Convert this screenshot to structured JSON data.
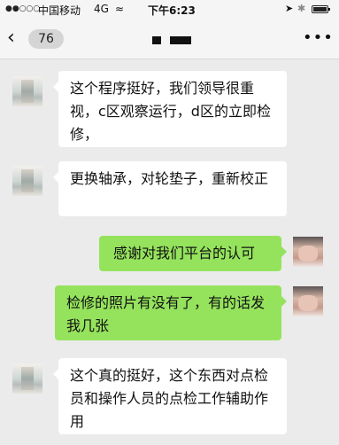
{
  "status_bar": {
    "signal": "●●○○○",
    "carrier": "中国移动",
    "network": "4G",
    "wifi": "≈",
    "time": "下午6:23",
    "location": "➤",
    "bluetooth": "✱"
  },
  "nav": {
    "back_glyph": "‹",
    "unread_count": "76",
    "more_glyph": "•••"
  },
  "messages": [
    {
      "side": "left",
      "text": "这个程序挺好，我们领导很重视，c区观察运行，d区的立即检修，"
    },
    {
      "side": "left",
      "text": "更换轴承，对轮垫子，重新校正"
    },
    {
      "side": "right",
      "text": "感谢对我们平台的认可"
    },
    {
      "side": "right",
      "text": "检修的照片有没有了，有的话发我几张"
    },
    {
      "side": "left",
      "text": "这个真的挺好，这个东西对点检员和操作人员的点检工作辅助作用"
    }
  ],
  "colors": {
    "chat_background": "#ebebeb",
    "incoming_bubble": "#ffffff",
    "outgoing_bubble": "#95e35d"
  }
}
